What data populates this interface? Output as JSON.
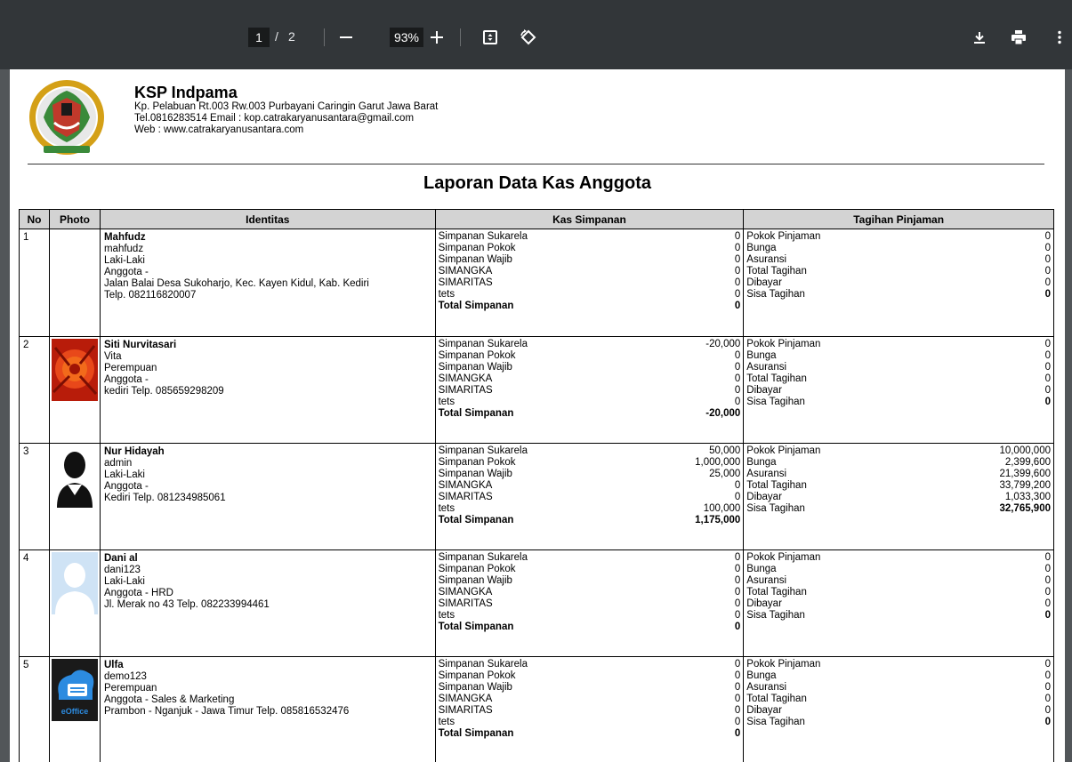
{
  "toolbar": {
    "page_current": "1",
    "page_sep": "/",
    "page_total": "2",
    "zoom": "93%",
    "icons": [
      "minus-icon",
      "plus-icon",
      "fit-page-icon",
      "rotate-icon",
      "download-icon",
      "print-icon",
      "more-vert-icon"
    ]
  },
  "header": {
    "company_name": "KSP Indpama",
    "address": "Kp. Pelabuan Rt.003 Rw.003 Purbayani Caringin Garut Jawa Barat",
    "contact": "Tel.0816283514 Email : kop.catrakaryanusantara@gmail.com",
    "web": "Web : www.catrakaryanusantara.com"
  },
  "report_title": "Laporan Data Kas Anggota",
  "table": {
    "headers": {
      "no": "No",
      "photo": "Photo",
      "identitas": "Identitas",
      "kas": "Kas Simpanan",
      "tagihan": "Tagihan Pinjaman"
    },
    "kas_labels": [
      "Simpanan Sukarela",
      "Simpanan Pokok",
      "Simpanan Wajib",
      "SIMANGKA",
      "SIMARITAS",
      "tets"
    ],
    "kas_total_label": "Total Simpanan",
    "tagihan_labels": [
      "Pokok Pinjaman",
      "Bunga",
      "Asuransi",
      "Total Tagihan",
      "Dibayar",
      "Sisa Tagihan"
    ],
    "rows": [
      {
        "no": "1",
        "photo": "none",
        "name": "Mahfudz",
        "lines": [
          "mahfudz",
          "Laki-Laki",
          "Anggota -",
          "Jalan Balai Desa Sukoharjo, Kec. Kayen Kidul, Kab. Kediri",
          "Telp. 082116820007"
        ],
        "kas": [
          "0",
          "0",
          "0",
          "0",
          "0",
          "0"
        ],
        "kas_total": "0",
        "tagihan": [
          "0",
          "0",
          "0",
          "0",
          "0",
          "0"
        ]
      },
      {
        "no": "2",
        "photo": "flower",
        "name": "Siti Nurvitasari",
        "lines": [
          "Vita",
          "Perempuan",
          "Anggota -",
          "kediri Telp. 085659298209"
        ],
        "kas": [
          "-20,000",
          "0",
          "0",
          "0",
          "0",
          "0"
        ],
        "kas_total": "-20,000",
        "tagihan": [
          "0",
          "0",
          "0",
          "0",
          "0",
          "0"
        ]
      },
      {
        "no": "3",
        "photo": "avatar-dark",
        "name": "Nur Hidayah",
        "lines": [
          "admin",
          "Laki-Laki",
          "Anggota -",
          "Kediri Telp. 081234985061"
        ],
        "kas": [
          "50,000",
          "1,000,000",
          "25,000",
          "0",
          "0",
          "100,000"
        ],
        "kas_total": "1,175,000",
        "tagihan": [
          "10,000,000",
          "2,399,600",
          "21,399,600",
          "33,799,200",
          "1,033,300",
          "32,765,900"
        ]
      },
      {
        "no": "4",
        "photo": "avatar-blue",
        "name": "Dani al",
        "lines": [
          "dani123",
          "Laki-Laki",
          "Anggota - HRD",
          "Jl. Merak no 43 Telp. 082233994461"
        ],
        "kas": [
          "0",
          "0",
          "0",
          "0",
          "0",
          "0"
        ],
        "kas_total": "0",
        "tagihan": [
          "0",
          "0",
          "0",
          "0",
          "0",
          "0"
        ]
      },
      {
        "no": "5",
        "photo": "eoffice",
        "photo_text": "eOffice",
        "name": "Ulfa",
        "lines": [
          "demo123",
          "Perempuan",
          "Anggota - Sales & Marketing",
          "Prambon - Nganjuk - Jawa Timur Telp. 085816532476"
        ],
        "kas": [
          "0",
          "0",
          "0",
          "0",
          "0",
          "0"
        ],
        "kas_total": "0",
        "tagihan": [
          "0",
          "0",
          "0",
          "0",
          "0",
          "0"
        ]
      }
    ]
  }
}
